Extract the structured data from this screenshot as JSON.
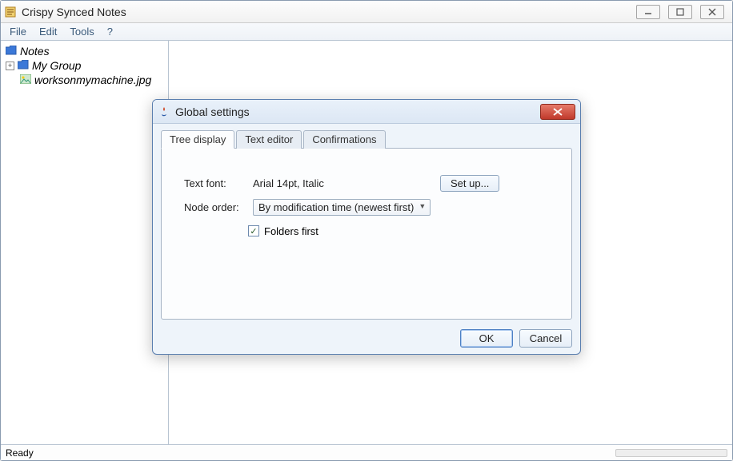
{
  "window": {
    "title": "Crispy Synced Notes"
  },
  "menu": {
    "file": "File",
    "edit": "Edit",
    "tools": "Tools",
    "help": "?"
  },
  "tree": {
    "root": "Notes",
    "group": "My Group",
    "file": "worksonmymachine.jpg"
  },
  "status": {
    "text": "Ready"
  },
  "dialog": {
    "title": "Global settings",
    "tabs": {
      "tree_display": "Tree display",
      "text_editor": "Text editor",
      "confirmations": "Confirmations"
    },
    "form": {
      "text_font_label": "Text font:",
      "text_font_value": "Arial 14pt, Italic",
      "setup_button": "Set up...",
      "node_order_label": "Node order:",
      "node_order_value": "By modification time (newest first)",
      "folders_first_label": "Folders first",
      "folders_first_checked": true
    },
    "buttons": {
      "ok": "OK",
      "cancel": "Cancel"
    }
  }
}
